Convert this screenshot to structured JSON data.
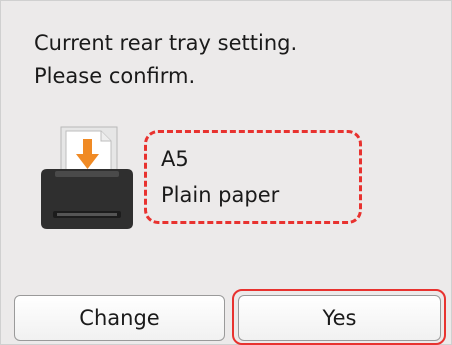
{
  "message": {
    "line1": "Current rear tray setting.",
    "line2": "Please confirm."
  },
  "paper": {
    "size": "A5",
    "type": "Plain paper"
  },
  "buttons": {
    "change": "Change",
    "yes": "Yes"
  },
  "icons": {
    "printer": "printer-rear-tray-icon",
    "arrow": "down-arrow-icon"
  },
  "colors": {
    "highlight": "#e8322f",
    "arrow": "#f08a24",
    "screen_bg": "#eceaea"
  }
}
